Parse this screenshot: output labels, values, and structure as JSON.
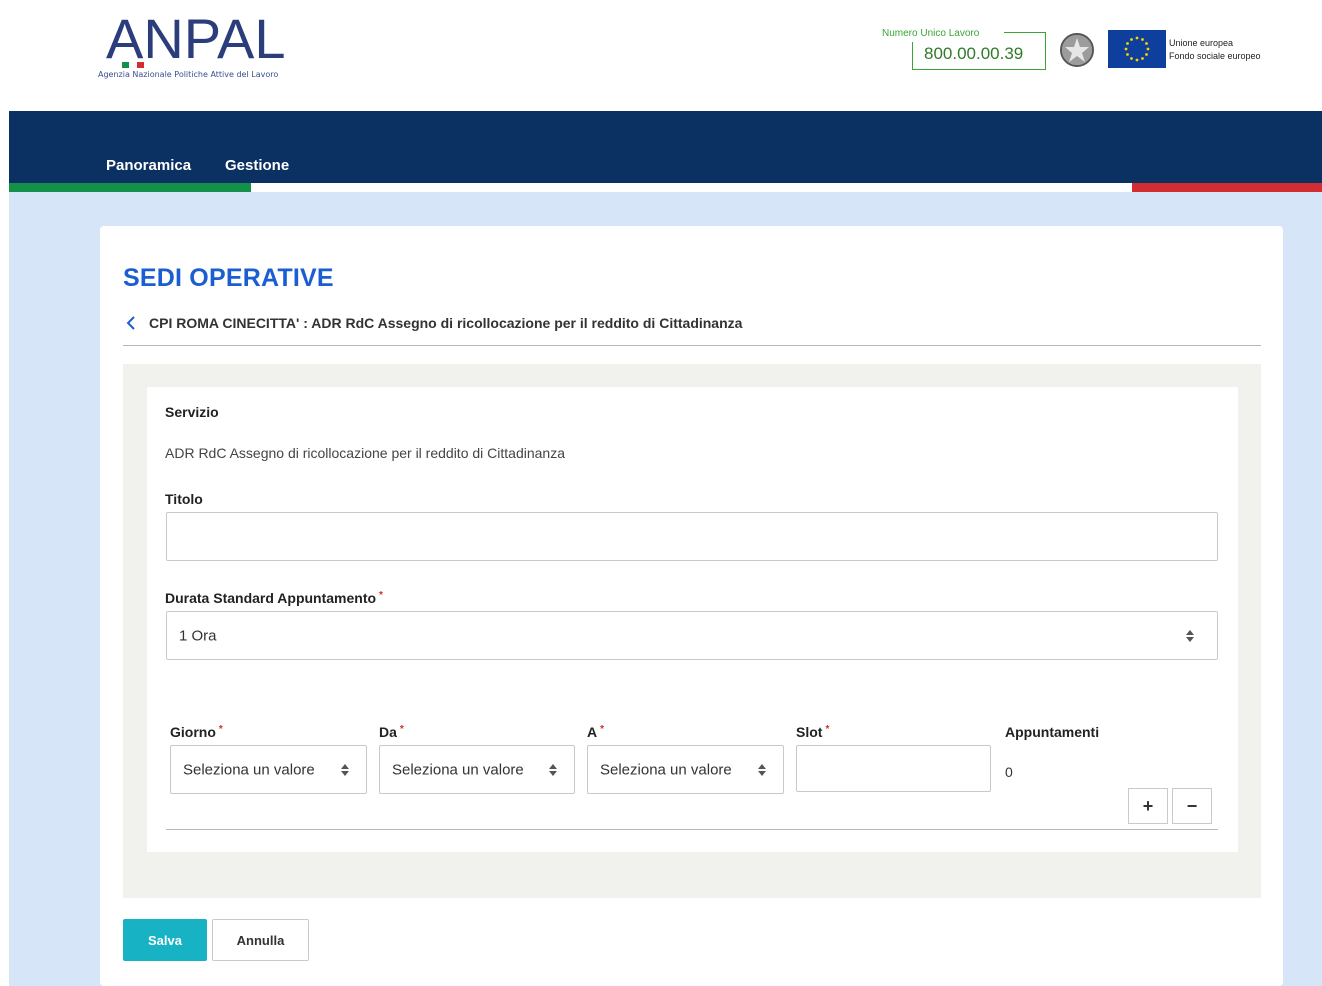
{
  "header": {
    "logo_text": "ANPAL",
    "logo_subtitle": "Agenzia Nazionale Politiche Attive del Lavoro",
    "phone_label": "Numero Unico Lavoro",
    "phone_number": "800.00.00.39",
    "eu_line1": "Unione europea",
    "eu_line2": "Fondo sociale europeo"
  },
  "nav": {
    "items": [
      {
        "label": "Panoramica"
      },
      {
        "label": "Gestione"
      }
    ]
  },
  "page": {
    "title": "SEDI OPERATIVE",
    "breadcrumb": "CPI ROMA CINECITTA' : ADR RdC Assegno di ricollocazione per il reddito di Cittadinanza"
  },
  "form": {
    "servizio_label": "Servizio",
    "servizio_value": "ADR RdC Assegno di ricollocazione per il reddito di Cittadinanza",
    "titolo_label": "Titolo",
    "titolo_value": "",
    "durata_label": "Durata Standard Appuntamento",
    "durata_value": "1 Ora",
    "required_mark": "*",
    "giorno_label": "Giorno",
    "da_label": "Da",
    "a_label": "A",
    "slot_label": "Slot",
    "appuntamenti_label": "Appuntamenti",
    "select_placeholder": "Seleziona un valore",
    "giorno_value": "Seleziona un valore",
    "da_value": "Seleziona un valore",
    "a_value": "Seleziona un valore",
    "slot_value": "",
    "appuntamenti_value": "0",
    "add_label": "+",
    "remove_label": "−"
  },
  "actions": {
    "save_label": "Salva",
    "cancel_label": "Annulla"
  },
  "colors": {
    "navy": "#0b3062",
    "title_blue": "#1a5ed1",
    "save_teal": "#17b3c4",
    "italy_green": "#13914a",
    "italy_red": "#d12d32",
    "page_bg": "#d6e6f8"
  }
}
